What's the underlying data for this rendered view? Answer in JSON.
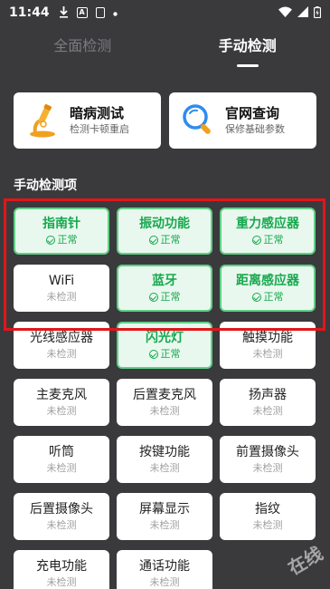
{
  "status_bar": {
    "time": "11:44",
    "icons": [
      "download-icon",
      "a-notification-icon",
      "square-notification-icon",
      "dot-icon",
      "wifi-icon",
      "signal-icon",
      "battery-icon"
    ]
  },
  "tabs": [
    {
      "label": "全面检测",
      "active": false
    },
    {
      "label": "手动检测",
      "active": true
    }
  ],
  "features": [
    {
      "title": "暗病测试",
      "subtitle": "检测卡顿重启",
      "icon": "microscope-icon"
    },
    {
      "title": "官网查询",
      "subtitle": "保修基础参数",
      "icon": "magnifier-icon"
    }
  ],
  "section_title": "手动检测项",
  "items": [
    {
      "name": "指南针",
      "status": "正常",
      "ok": true
    },
    {
      "name": "振动功能",
      "status": "正常",
      "ok": true
    },
    {
      "name": "重力感应器",
      "status": "正常",
      "ok": true
    },
    {
      "name": "WiFi",
      "status": "未检测",
      "ok": false
    },
    {
      "name": "蓝牙",
      "status": "正常",
      "ok": true
    },
    {
      "name": "距离感应器",
      "status": "正常",
      "ok": true
    },
    {
      "name": "光线感应器",
      "status": "未检测",
      "ok": false
    },
    {
      "name": "闪光灯",
      "status": "正常",
      "ok": true
    },
    {
      "name": "触摸功能",
      "status": "未检测",
      "ok": false
    },
    {
      "name": "主麦克风",
      "status": "未检测",
      "ok": false
    },
    {
      "name": "后置麦克风",
      "status": "未检测",
      "ok": false
    },
    {
      "name": "扬声器",
      "status": "未检测",
      "ok": false
    },
    {
      "name": "听筒",
      "status": "未检测",
      "ok": false
    },
    {
      "name": "按键功能",
      "status": "未检测",
      "ok": false
    },
    {
      "name": "前置摄像头",
      "status": "未检测",
      "ok": false
    },
    {
      "name": "后置摄像头",
      "status": "未检测",
      "ok": false
    },
    {
      "name": "屏幕显示",
      "status": "未检测",
      "ok": false
    },
    {
      "name": "指纹",
      "status": "未检测",
      "ok": false
    },
    {
      "name": "充电功能",
      "status": "未检测",
      "ok": false
    },
    {
      "name": "通话功能",
      "status": "未检测",
      "ok": false
    }
  ],
  "colors": {
    "background": "#3a3a3d",
    "ok_green": "#17a84f",
    "highlight_red": "#e0161a"
  },
  "watermark": "在线"
}
